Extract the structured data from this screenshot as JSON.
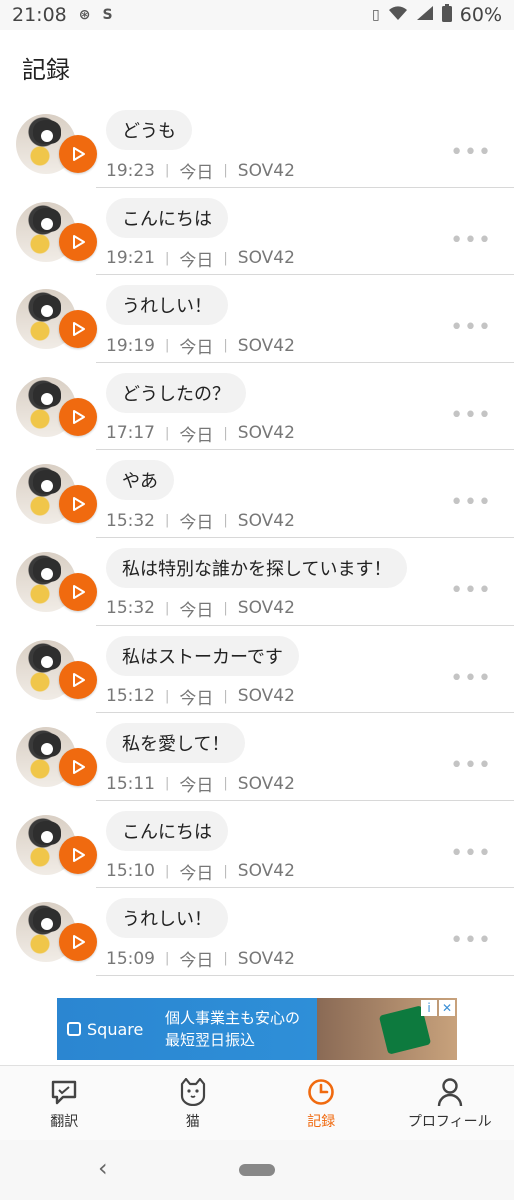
{
  "status": {
    "time": "21:08",
    "battery": "60%",
    "left_icons": [
      "nfc-icon",
      "s-app-icon"
    ],
    "right_icons": [
      "vibrate-icon",
      "wifi-icon",
      "signal-icon",
      "battery-icon"
    ]
  },
  "header": {
    "title": "記録"
  },
  "records": [
    {
      "text": "どうも",
      "time": "19:23",
      "day": "今日",
      "device": "SOV42"
    },
    {
      "text": "こんにちは",
      "time": "19:21",
      "day": "今日",
      "device": "SOV42"
    },
    {
      "text": "うれしい！",
      "time": "19:19",
      "day": "今日",
      "device": "SOV42"
    },
    {
      "text": "どうしたの？",
      "time": "17:17",
      "day": "今日",
      "device": "SOV42"
    },
    {
      "text": "やあ",
      "time": "15:32",
      "day": "今日",
      "device": "SOV42"
    },
    {
      "text": "私は特別な誰かを探しています！",
      "time": "15:32",
      "day": "今日",
      "device": "SOV42"
    },
    {
      "text": "私はストーカーです",
      "time": "15:12",
      "day": "今日",
      "device": "SOV42"
    },
    {
      "text": "私を愛して！",
      "time": "15:11",
      "day": "今日",
      "device": "SOV42"
    },
    {
      "text": "こんにちは",
      "time": "15:10",
      "day": "今日",
      "device": "SOV42"
    },
    {
      "text": "うれしい！",
      "time": "15:09",
      "day": "今日",
      "device": "SOV42"
    }
  ],
  "ad": {
    "brand": "Square",
    "line1": "個人事業主も安心の",
    "line2": "最短翌日振込"
  },
  "tabs": [
    {
      "label": "翻訳",
      "icon": "translate-chat-icon"
    },
    {
      "label": "猫",
      "icon": "cat-face-icon"
    },
    {
      "label": "記録",
      "icon": "clock-icon",
      "active": true
    },
    {
      "label": "プロフィール",
      "icon": "person-icon"
    }
  ],
  "colors": {
    "accent": "#f06a0f",
    "bubble": "#f2f2f2"
  }
}
